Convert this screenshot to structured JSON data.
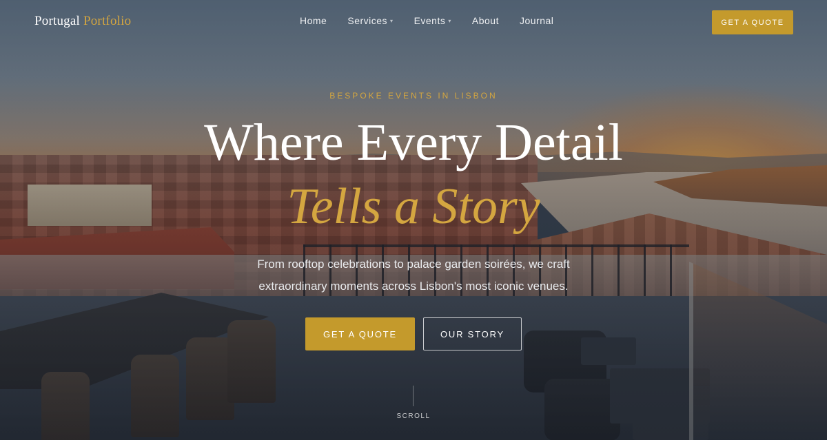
{
  "brand": {
    "name_primary": "Portugal",
    "name_accent": "Portfolio",
    "accent_color": "#c49a2c"
  },
  "nav": {
    "items": [
      {
        "label": "Home",
        "has_dropdown": false
      },
      {
        "label": "Services",
        "has_dropdown": true
      },
      {
        "label": "Events",
        "has_dropdown": true
      },
      {
        "label": "About",
        "has_dropdown": false
      },
      {
        "label": "Journal",
        "has_dropdown": false
      }
    ],
    "dropdown_icon": "chevron-down-icon",
    "cta_label": "GET A QUOTE"
  },
  "hero": {
    "eyebrow": "BESPOKE EVENTS IN LISBON",
    "headline_line1": "Where Every Detail",
    "headline_line2": "Tells a Story",
    "subtitle_line1": "From rooftop celebrations to palace garden soirées, we craft",
    "subtitle_line2": "extraordinary moments across Lisbon's most iconic venues.",
    "primary_button": "GET A QUOTE",
    "secondary_button": "OUR STORY",
    "scroll_label": "SCROLL",
    "background_image": "Lisbon rooftop terrace at sunset overlooking red-roofed city and river"
  }
}
